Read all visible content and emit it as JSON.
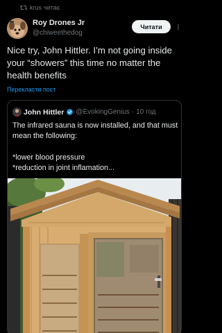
{
  "repost": {
    "label": "krus",
    "suffix": "читає"
  },
  "author": {
    "name": "Roy Drones Jr",
    "handle": "@chiweethedog"
  },
  "follow_label": "Читати",
  "tweet": {
    "text": "Nice try, John Hittler. I’m not going inside your “showers” this time no matter the health benefits",
    "translate": "Перекласти пост"
  },
  "quote": {
    "name": "John Hittler",
    "handle": "@EvokingGenius",
    "separator": "·",
    "time": "10 год",
    "text": "The infrared sauna is now installed, and that must mean the following:",
    "bullets": [
      "*lower blood pressure",
      "*reduction in joint inflamation..."
    ]
  },
  "colors": {
    "accent": "#1d9bf0",
    "verified": "#1d9bf0",
    "muted": "#71767b",
    "border": "#2f3336",
    "button_bg": "#eff3f4"
  }
}
